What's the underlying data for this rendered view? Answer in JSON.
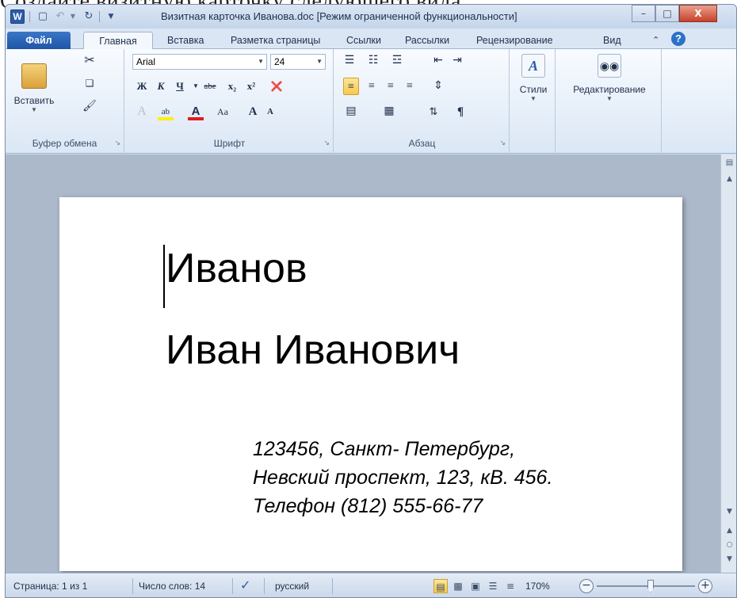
{
  "background": {
    "instruction_text": "Создайте визитную карточку следующего вида:"
  },
  "window": {
    "app_icon": "W",
    "title": "Визитная карточка Иванова.doc [Режим ограниченной функциональности]",
    "minimize": "–",
    "maximize": "□",
    "close": "X"
  },
  "tabs": {
    "file": "Файл",
    "home": "Главная",
    "insert": "Вставка",
    "layout": "Разметка страницы",
    "references": "Ссылки",
    "mailings": "Рассылки",
    "review": "Рецензирование",
    "view": "Вид"
  },
  "ribbon": {
    "clipboard": {
      "label": "Буфер обмена",
      "paste": "Вставить"
    },
    "font": {
      "label": "Шрифт",
      "name": "Arial",
      "size": "24",
      "bold": "Ж",
      "italic": "К",
      "underline": "Ч",
      "strike": "abe",
      "sub": "x₂",
      "sup": "x²",
      "case": "Aa",
      "grow": "A",
      "shrink": "A"
    },
    "paragraph": {
      "label": "Абзац"
    },
    "styles": {
      "label": "Стили"
    },
    "editing": {
      "label": "Редактирование"
    }
  },
  "document": {
    "line1": "Иванов",
    "line2": "Иван Иванович",
    "address1": "123456, Санкт- Петербург,",
    "address2": "Невский проспект, 123, кВ. 456.",
    "phone": "Телефон (812) 555-66-77"
  },
  "status": {
    "page": "Страница: 1 из 1",
    "words": "Число слов: 14",
    "language": "русский",
    "zoom": "170%"
  },
  "colors": {
    "accent": "#2a5caa",
    "file_tab": "#1f55a6",
    "active_button": "#f9c84b"
  }
}
